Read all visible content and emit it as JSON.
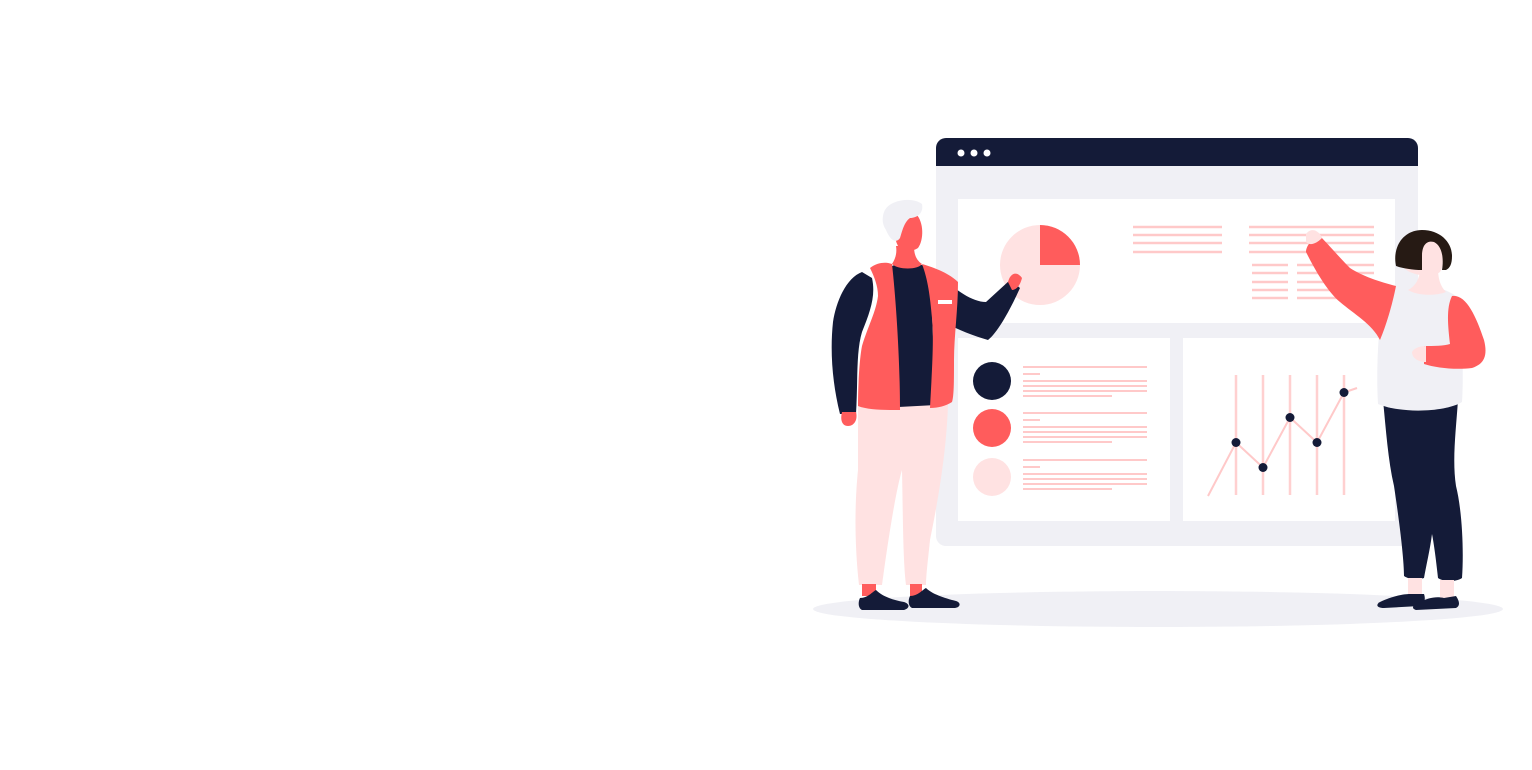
{
  "illustration": {
    "subject": "dashboard-presentation",
    "icons": [
      "browser-window",
      "pie-chart",
      "line-chart",
      "person-man",
      "person-woman"
    ],
    "colors": {
      "navy": "#141b38",
      "coral": "#ff5c5c",
      "blush": "#ffe2e2",
      "panel": "#f0f0f5",
      "white": "#ffffff",
      "hair": "#261a14"
    },
    "pie_chart": {
      "highlighted_fraction": 0.25
    },
    "line_chart": {
      "points": [
        3,
        1,
        5,
        3,
        7
      ]
    },
    "status_dots": [
      "navy",
      "coral",
      "blush"
    ]
  }
}
